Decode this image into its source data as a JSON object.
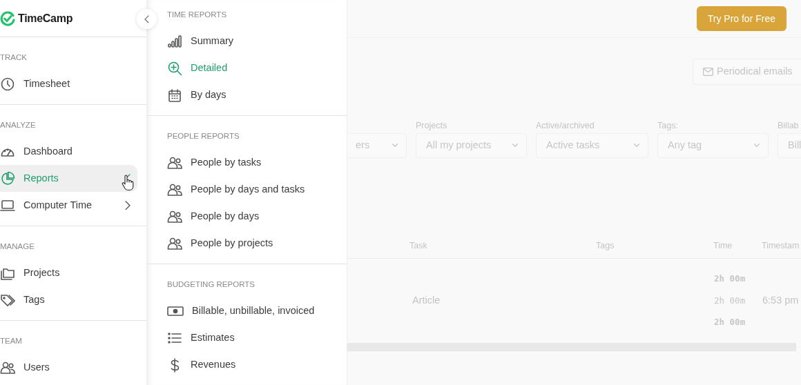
{
  "logo": {
    "text": "TimeCamp"
  },
  "sidebar": {
    "sections": [
      {
        "heading": "TRACK",
        "items": [
          {
            "label": "Timesheet",
            "kind": "link",
            "selected": false
          }
        ]
      },
      {
        "heading": "ANALYZE",
        "items": [
          {
            "label": "Dashboard",
            "kind": "link",
            "selected": false
          },
          {
            "label": "Reports",
            "kind": "group",
            "expanded": true,
            "selected": true
          },
          {
            "label": "Computer Time",
            "kind": "group",
            "expanded": false,
            "selected": false
          }
        ]
      },
      {
        "heading": "MANAGE",
        "items": [
          {
            "label": "Projects",
            "kind": "link",
            "selected": false
          },
          {
            "label": "Tags",
            "kind": "link",
            "selected": false
          }
        ]
      },
      {
        "heading": "TEAM",
        "items": [
          {
            "label": "Users",
            "kind": "link",
            "selected": false
          }
        ]
      }
    ]
  },
  "submenu": {
    "sections": [
      {
        "heading": "TIME REPORTS",
        "items": [
          {
            "label": "Summary",
            "selected": false
          },
          {
            "label": "Detailed",
            "selected": true
          },
          {
            "label": "By days",
            "selected": false
          }
        ]
      },
      {
        "heading": "PEOPLE REPORTS",
        "items": [
          {
            "label": "People by tasks",
            "selected": false
          },
          {
            "label": "People by days and tasks",
            "selected": false
          },
          {
            "label": "People by days",
            "selected": false
          },
          {
            "label": "People by projects",
            "selected": false
          }
        ]
      },
      {
        "heading": "BUDGETING REPORTS",
        "items": [
          {
            "label": "Billable, unbillable, invoiced",
            "selected": false
          },
          {
            "label": "Estimates",
            "selected": false
          },
          {
            "label": "Revenues",
            "selected": false
          }
        ]
      }
    ]
  },
  "header": {
    "button": "Try Pro for Free"
  },
  "periodical_emails": {
    "label": "Periodical emails"
  },
  "filters": [
    {
      "value": "ers"
    },
    {
      "label": "Projects",
      "value": "All my projects"
    },
    {
      "label": "Active/archived",
      "value": "Active tasks"
    },
    {
      "label": "Tags:",
      "value": "Any tag"
    },
    {
      "label": "Billab",
      "value": "Bill"
    }
  ],
  "table": {
    "columns": [
      "Task",
      "Tags",
      "Time",
      "Timestam"
    ],
    "rows": [
      {
        "task": "Article",
        "times": [
          {
            "text": "2h 00m",
            "bold": true
          },
          {
            "text": "2h 00m",
            "bold": false
          },
          {
            "text": "2h 00m",
            "bold": true
          }
        ],
        "timestamp": "6:53 pm"
      }
    ]
  }
}
